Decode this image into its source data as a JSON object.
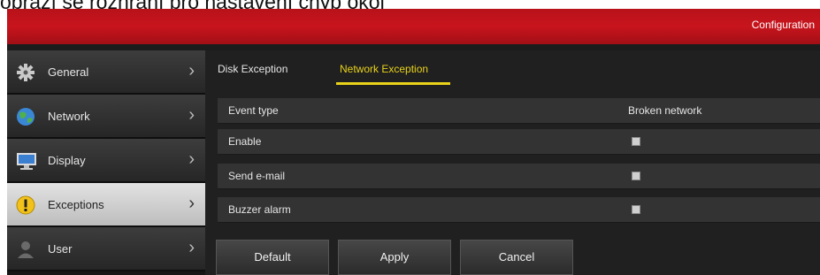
{
  "caption": "obrazí se rozhraní pro nastavení chyb okol",
  "header": {
    "title": "Configuration"
  },
  "sidebar": {
    "items": [
      {
        "label": "General",
        "icon": "gear-icon",
        "chevron": "›"
      },
      {
        "label": "Network",
        "icon": "globe-icon",
        "chevron": "›"
      },
      {
        "label": "Display",
        "icon": "monitor-icon",
        "chevron": "›"
      },
      {
        "label": "Exceptions",
        "icon": "warning-icon",
        "chevron": "›",
        "active": true
      },
      {
        "label": "User",
        "icon": "user-icon",
        "chevron": "›"
      }
    ]
  },
  "tabs": [
    {
      "label": "Disk Exception",
      "active": false
    },
    {
      "label": "Network Exception",
      "active": true
    }
  ],
  "settings": {
    "event_type_label": "Event type",
    "event_type_value": "Broken network",
    "enable_label": "Enable",
    "enable_checked": false,
    "send_email_label": "Send e-mail",
    "send_email_checked": false,
    "buzzer_label": "Buzzer alarm",
    "buzzer_checked": false
  },
  "buttons": {
    "default_label": "Default",
    "apply_label": "Apply",
    "cancel_label": "Cancel"
  },
  "colors": {
    "accent_red": "#c8141d",
    "tab_active": "#e8d21a"
  }
}
